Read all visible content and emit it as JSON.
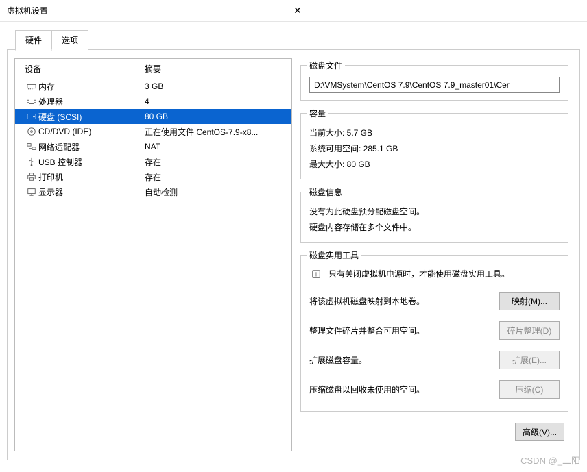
{
  "title": "虚拟机设置",
  "tabs": {
    "hardware": "硬件",
    "options": "选项"
  },
  "headers": {
    "device": "设备",
    "summary": "摘要"
  },
  "devices": [
    {
      "name": "内存",
      "summary": "3 GB"
    },
    {
      "name": "处理器",
      "summary": "4"
    },
    {
      "name": "硬盘 (SCSI)",
      "summary": "80 GB"
    },
    {
      "name": "CD/DVD (IDE)",
      "summary": "正在使用文件 CentOS-7.9-x8..."
    },
    {
      "name": "网络适配器",
      "summary": "NAT"
    },
    {
      "name": "USB 控制器",
      "summary": "存在"
    },
    {
      "name": "打印机",
      "summary": "存在"
    },
    {
      "name": "显示器",
      "summary": "自动检测"
    }
  ],
  "diskfile": {
    "legend": "磁盘文件",
    "path": "D:\\VMSystem\\CentOS 7.9\\CentOS 7.9_master01\\Cer"
  },
  "capacity": {
    "legend": "容量",
    "current": "当前大小: 5.7 GB",
    "free": "系统可用空间: 285.1 GB",
    "max": "最大大小: 80 GB"
  },
  "diskinfo": {
    "legend": "磁盘信息",
    "line1": "没有为此硬盘预分配磁盘空间。",
    "line2": "硬盘内容存储在多个文件中。"
  },
  "tools": {
    "legend": "磁盘实用工具",
    "note": "只有关闭虚拟机电源时，才能使用磁盘实用工具。",
    "map_label": "将该虚拟机磁盘映射到本地卷。",
    "map_btn": "映射(M)...",
    "defrag_label": "整理文件碎片并整合可用空间。",
    "defrag_btn": "碎片整理(D)",
    "expand_label": "扩展磁盘容量。",
    "expand_btn": "扩展(E)...",
    "compact_label": "压缩磁盘以回收未使用的空间。",
    "compact_btn": "压缩(C)"
  },
  "advanced_btn": "高级(V)...",
  "watermark": "CSDN @_二阳"
}
